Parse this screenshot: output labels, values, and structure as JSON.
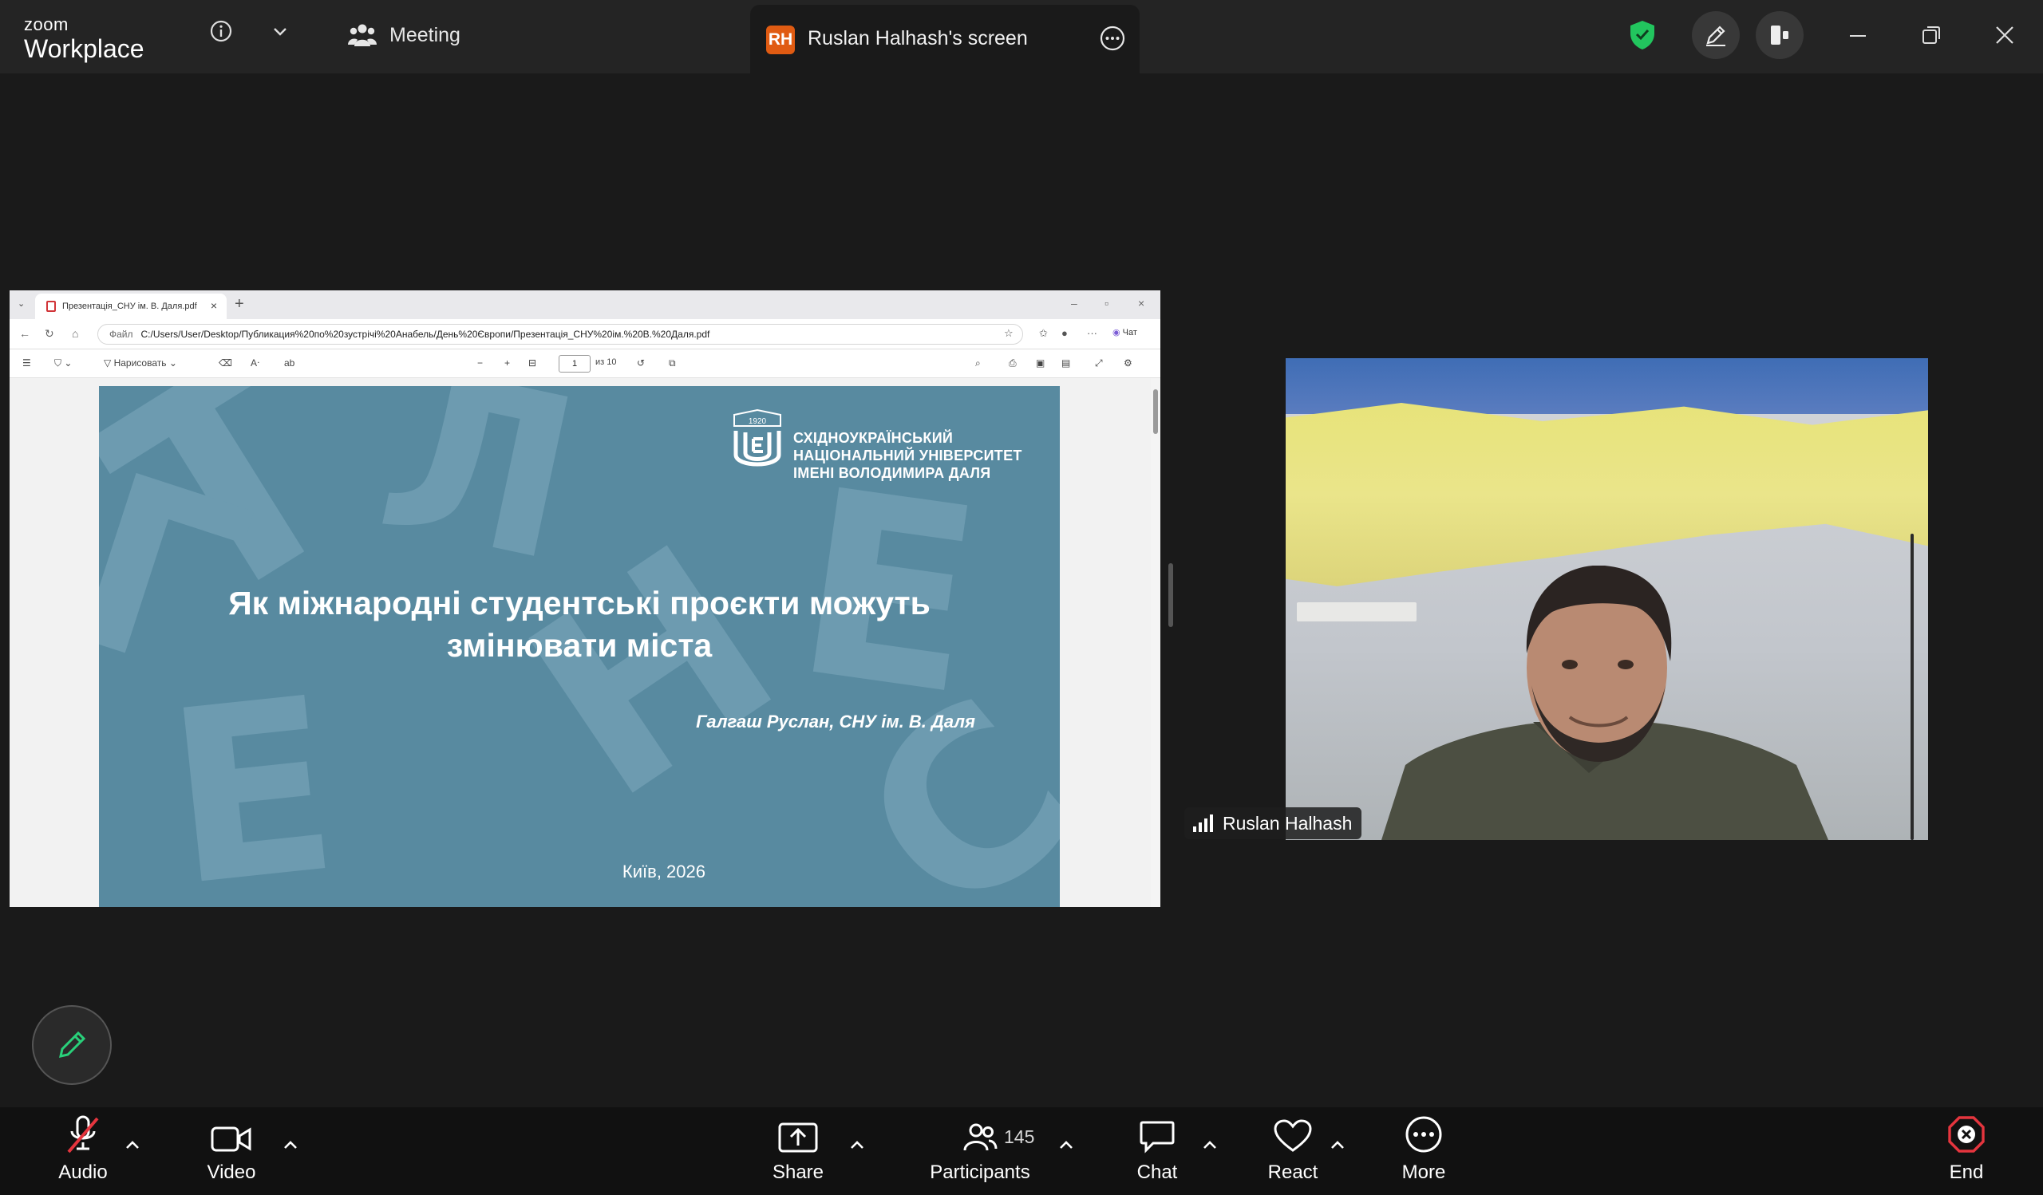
{
  "app": {
    "brand_line1": "zoom",
    "brand_line2": "Workplace",
    "meeting_label": "Meeting",
    "screen_tab_initials": "RH",
    "screen_tab_title": "Ruslan Halhash's screen",
    "colors": {
      "topbar": "#242424",
      "bg": "#1a1a1a",
      "shield": "#22c55e",
      "badge": "#e05b12",
      "end": "#e5353e"
    }
  },
  "shared_screen": {
    "browser_tab_title": "Презентація_СНУ ім. В. Даля.pdf",
    "url_prefix": "Файл",
    "url": "C:/Users/User/Desktop/Публикация%20по%20зустрічі%20Анабель/День%20Європи/Презентація_СНУ%20ім.%20В.%20Даля.pdf",
    "chat_label": "Чат",
    "draw_label": "Нарисовать",
    "page_current": "1",
    "page_total": "из 10",
    "slide": {
      "title_line1": "Як міжнародні студентські проєкти можуть",
      "title_line2": "змінювати міста",
      "author": "Галгаш Руслан, СНУ ім. В. Даля",
      "city_year": "Київ, 2026",
      "logo_year": "1920",
      "logo_line1": "СХІДНОУКРАЇНСЬКИЙ",
      "logo_line2": "НАЦІОНАЛЬНИЙ УНІВЕРСИТЕТ",
      "logo_line3": "ІМЕНІ ВОЛОДИМИРА ДАЛЯ"
    }
  },
  "video": {
    "participant_name": "Ruslan Halhash"
  },
  "toolbar": {
    "audio": "Audio",
    "video": "Video",
    "share": "Share",
    "participants": "Participants",
    "participants_count": "145",
    "chat": "Chat",
    "react": "React",
    "more": "More",
    "end": "End"
  }
}
